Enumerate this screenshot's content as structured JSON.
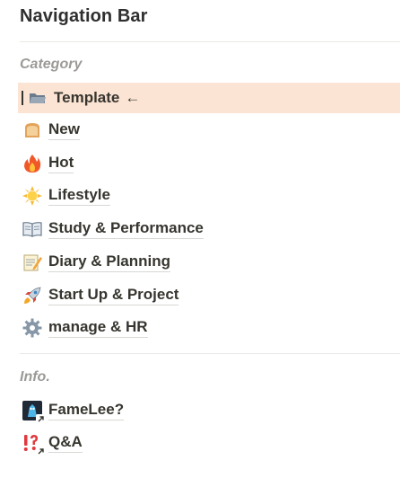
{
  "header": {
    "title": "Navigation Bar"
  },
  "sections": {
    "category_label": "Category",
    "info_label": "Info."
  },
  "category_items": [
    {
      "label": "Template",
      "icon": "folder-icon",
      "active": true,
      "suffix": "←"
    },
    {
      "label": "New",
      "icon": "bread-icon"
    },
    {
      "label": "Hot",
      "icon": "fire-icon"
    },
    {
      "label": "Lifestyle",
      "icon": "sun-icon"
    },
    {
      "label": "Study & Performance",
      "icon": "book-icon"
    },
    {
      "label": "Diary & Planning",
      "icon": "memo-icon"
    },
    {
      "label": "Start Up & Project",
      "icon": "rocket-icon"
    },
    {
      "label": "manage & HR",
      "icon": "gear-icon"
    }
  ],
  "info_items": [
    {
      "label": "FameLee?",
      "icon": "avatar-link-icon"
    },
    {
      "label": "Q&A",
      "icon": "exclamation-question-link-icon"
    }
  ],
  "colors": {
    "active_row_bg": "#fbe4d3",
    "section_label": "#9b9a97",
    "text": "#37352f"
  }
}
